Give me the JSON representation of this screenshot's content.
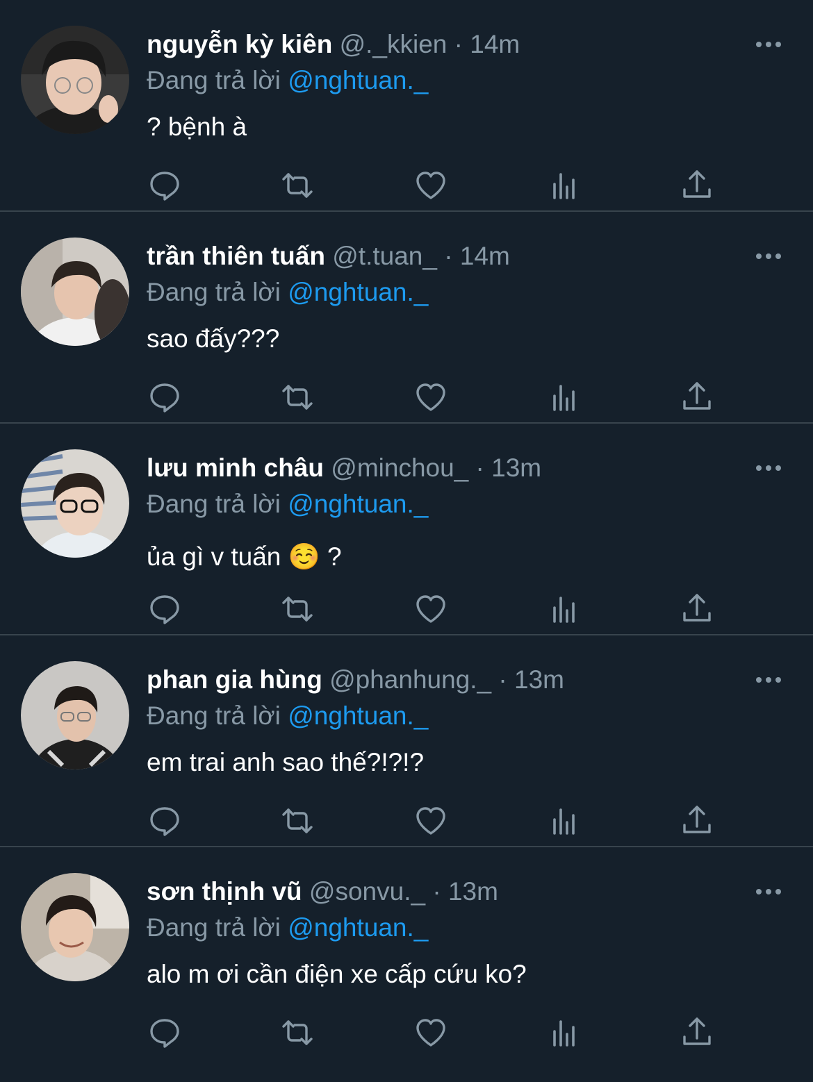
{
  "colors": {
    "background": "#15202b",
    "divider": "#38444d",
    "primary_text": "#ffffff",
    "secondary_text": "#8899a6",
    "mention": "#1d9bf0"
  },
  "icons": {
    "more": "more-horizontal-icon",
    "reply": "reply-bubble-icon",
    "retweet": "retweet-icon",
    "like": "heart-icon",
    "views": "analytics-bars-icon",
    "share": "share-upload-icon"
  },
  "tweets": [
    {
      "name": "nguyễn kỳ kiên",
      "handle": "@._kkien",
      "separator": "·",
      "time": "14m",
      "reply_prefix": "Đang trả lời",
      "reply_to": "@nghtuan._",
      "text": "? bệnh à"
    },
    {
      "name": "trần thiên tuấn",
      "handle": "@t.tuan_",
      "separator": "·",
      "time": "14m",
      "reply_prefix": "Đang trả lời",
      "reply_to": "@nghtuan._",
      "text": "sao đấy???"
    },
    {
      "name": "lưu minh châu",
      "handle": "@minchou_",
      "separator": "·",
      "time": "13m",
      "reply_prefix": "Đang trả lời",
      "reply_to": "@nghtuan._",
      "text": "ủa gì v tuấn ☺️ ?"
    },
    {
      "name": "phan gia hùng",
      "handle": "@phanhung._",
      "separator": "·",
      "time": "13m",
      "reply_prefix": "Đang trả lời",
      "reply_to": "@nghtuan._",
      "text": "em trai anh sao thế?!?!?"
    },
    {
      "name": "sơn thịnh vũ",
      "handle": "@sonvu._",
      "separator": "·",
      "time": "13m",
      "reply_prefix": "Đang trả lời",
      "reply_to": "@nghtuan._",
      "text": "alo m ơi cần điện xe cấp cứu ko?"
    }
  ]
}
